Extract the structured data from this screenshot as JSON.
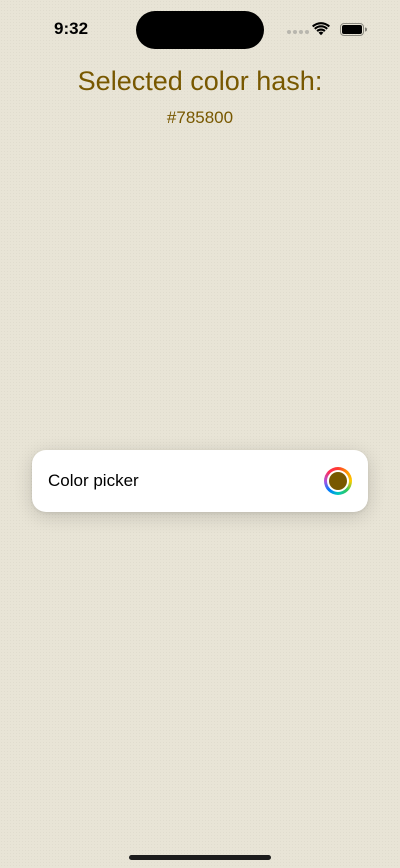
{
  "status_bar": {
    "time": "9:32",
    "icons": [
      "signal-dots-icon",
      "wifi-icon",
      "battery-icon"
    ]
  },
  "main": {
    "title": "Selected color hash:",
    "hash_value": "#785800"
  },
  "picker": {
    "label": "Color picker",
    "selected_color": "#785800"
  },
  "colors": {
    "accent_text": "#785800",
    "background": "#e8e4d6",
    "card": "#ffffff"
  }
}
